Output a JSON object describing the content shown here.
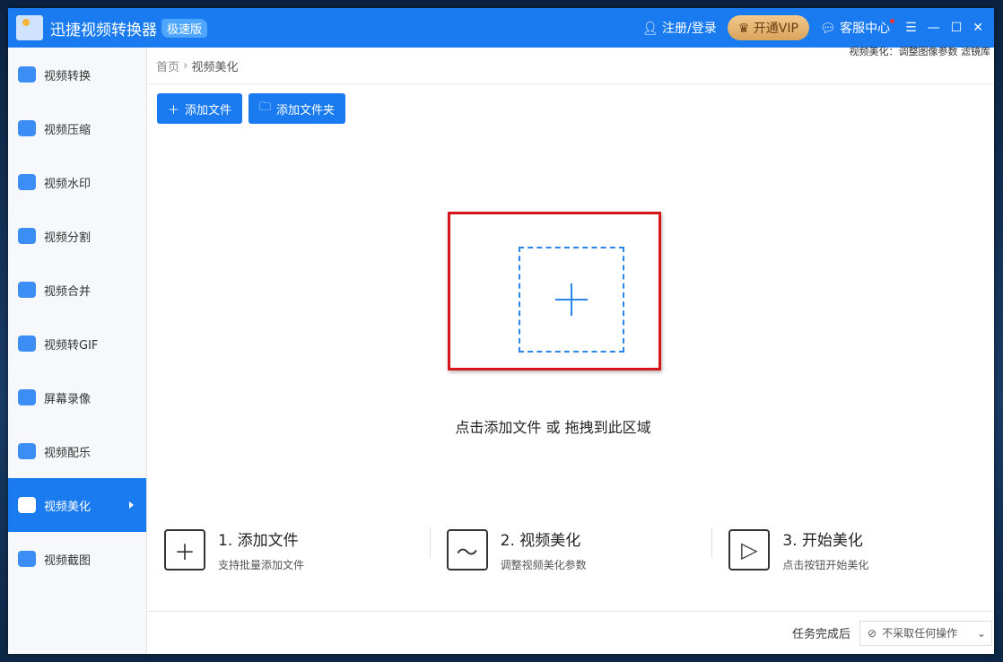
{
  "app": {
    "title": "迅捷视频转换器",
    "edition": "极速版"
  },
  "topbar": {
    "login": "注册/登录",
    "vip": "开通VIP",
    "service": "客服中心"
  },
  "sidebar": {
    "items": [
      {
        "label": "视频转换"
      },
      {
        "label": "视频压缩"
      },
      {
        "label": "视频水印"
      },
      {
        "label": "视频分割"
      },
      {
        "label": "视频合并"
      },
      {
        "label": "视频转GIF"
      },
      {
        "label": "屏幕录像"
      },
      {
        "label": "视频配乐"
      },
      {
        "label": "视频美化",
        "active": true
      },
      {
        "label": "视频截图"
      }
    ]
  },
  "breadcrumb": {
    "home": "首页",
    "current": "视频美化"
  },
  "hint": "视频美化：调整图像参数 滤镜库",
  "toolbar": {
    "add_file": "添加文件",
    "add_folder": "添加文件夹"
  },
  "dropzone": {
    "text": "点击添加文件 或 拖拽到此区域"
  },
  "steps": [
    {
      "title": "1. 添加文件",
      "sub": "支持批量添加文件"
    },
    {
      "title": "2. 视频美化",
      "sub": "调整视频美化参数"
    },
    {
      "title": "3. 开始美化",
      "sub": "点击按钮开始美化"
    }
  ],
  "footer": {
    "label": "任务完成后",
    "option": "不采取任何操作"
  }
}
